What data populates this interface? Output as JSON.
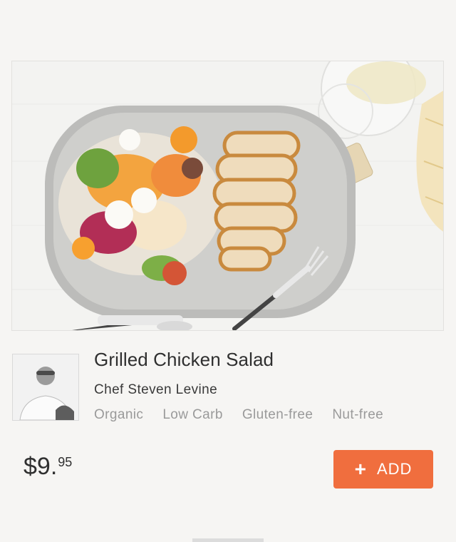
{
  "meal": {
    "title": "Grilled Chicken Salad",
    "chef": "Chef Steven Levine",
    "tags": [
      "Organic",
      "Low Carb",
      "Gluten-free",
      "Nut-free"
    ],
    "price": {
      "whole": "$9.",
      "cents": "95"
    },
    "image_subject": "grilled chicken salad on platter"
  },
  "actions": {
    "add_label": "ADD",
    "add_icon": "plus-icon"
  },
  "colors": {
    "background": "#f6f5f3",
    "accent": "#f06e3e",
    "title_text": "#2f2f2f",
    "tag_text": "#9a9a9a"
  }
}
